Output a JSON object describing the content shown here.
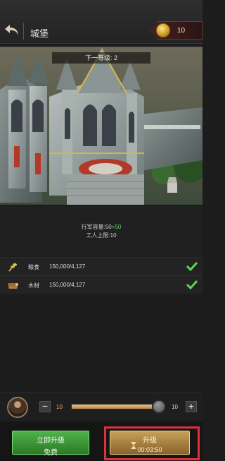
{
  "header": {
    "title": "城堡",
    "gold_count": "10",
    "back_icon": "back-arrow-icon",
    "gold_icon": "gold-coin-icon"
  },
  "scene": {
    "next_level_label": "下一等级: 2"
  },
  "stats": {
    "march_capacity_prefix": "行军容量:50",
    "march_capacity_bonus": "+50",
    "worker_limit": "工人上限:10"
  },
  "resources": [
    {
      "icon": "grain-icon",
      "name": "粮食",
      "value": "150,000/4,127",
      "met": true
    },
    {
      "icon": "wood-icon",
      "name": "木材",
      "value": "150,000/4,127",
      "met": true
    }
  ],
  "workers": {
    "min": "10",
    "max": "10",
    "fill_fraction": 1.0
  },
  "buttons": {
    "instant_upgrade": "立即升级",
    "instant_cost": "免费",
    "upgrade": "升级",
    "upgrade_time": "00:03:50"
  },
  "colors": {
    "accent_green": "#5fd35a",
    "highlight_red": "#e0303a",
    "gold": "#c7a15a"
  }
}
